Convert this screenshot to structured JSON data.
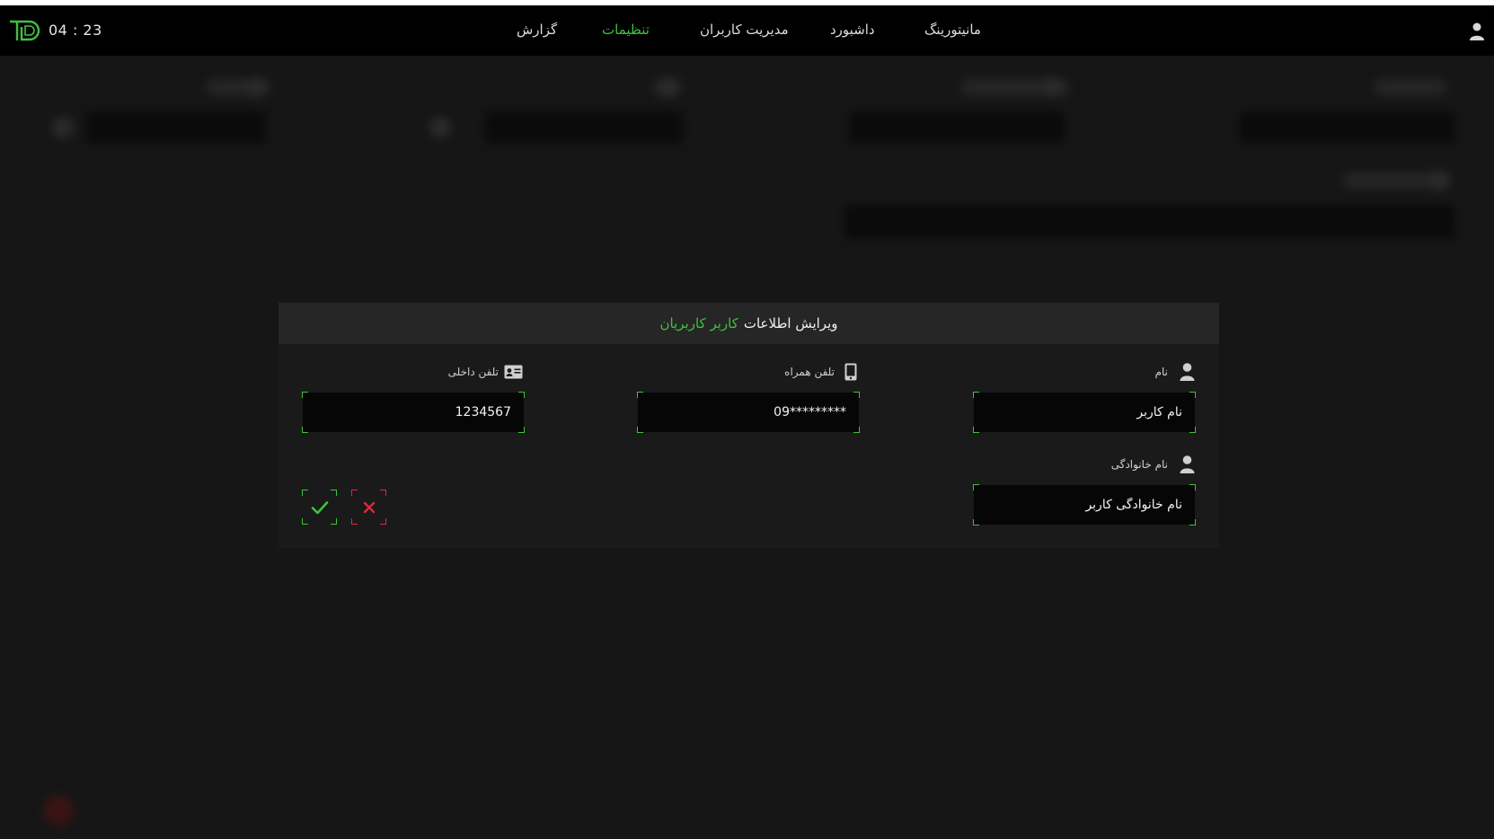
{
  "header": {
    "clock": "04 : 23",
    "nav": [
      {
        "label": "مانیتورینگ",
        "active": false
      },
      {
        "label": "داشبورد",
        "active": false
      },
      {
        "label": "مدیریت کاربران",
        "active": false
      },
      {
        "label": "تنظیمات",
        "active": true
      },
      {
        "label": "گزارش",
        "active": false
      }
    ],
    "logo_icon": "td-logo",
    "user_icon": "user-icon"
  },
  "modal": {
    "title": "ویرایش اطلاعات",
    "title_user": "کاربر کاربریان",
    "fields": {
      "first_name": {
        "label": "نام",
        "value": "نام کاربر",
        "icon": "user-icon"
      },
      "mobile": {
        "label": "تلفن همراه",
        "value": "09*********",
        "icon": "mobile-phone-icon"
      },
      "extension": {
        "label": "تلفن داخلی",
        "value": "1234567",
        "icon": "id-card-icon"
      },
      "last_name": {
        "label": "نام خانوادگی",
        "value": "نام خانوادگی کاربر",
        "icon": "user-icon"
      }
    },
    "actions": {
      "confirm_icon": "checkmark-icon",
      "cancel_icon": "close-icon"
    }
  },
  "colors": {
    "accent": "#3fc23f",
    "danger": "#e0283c",
    "background": "#161616",
    "navbar": "#000000"
  }
}
